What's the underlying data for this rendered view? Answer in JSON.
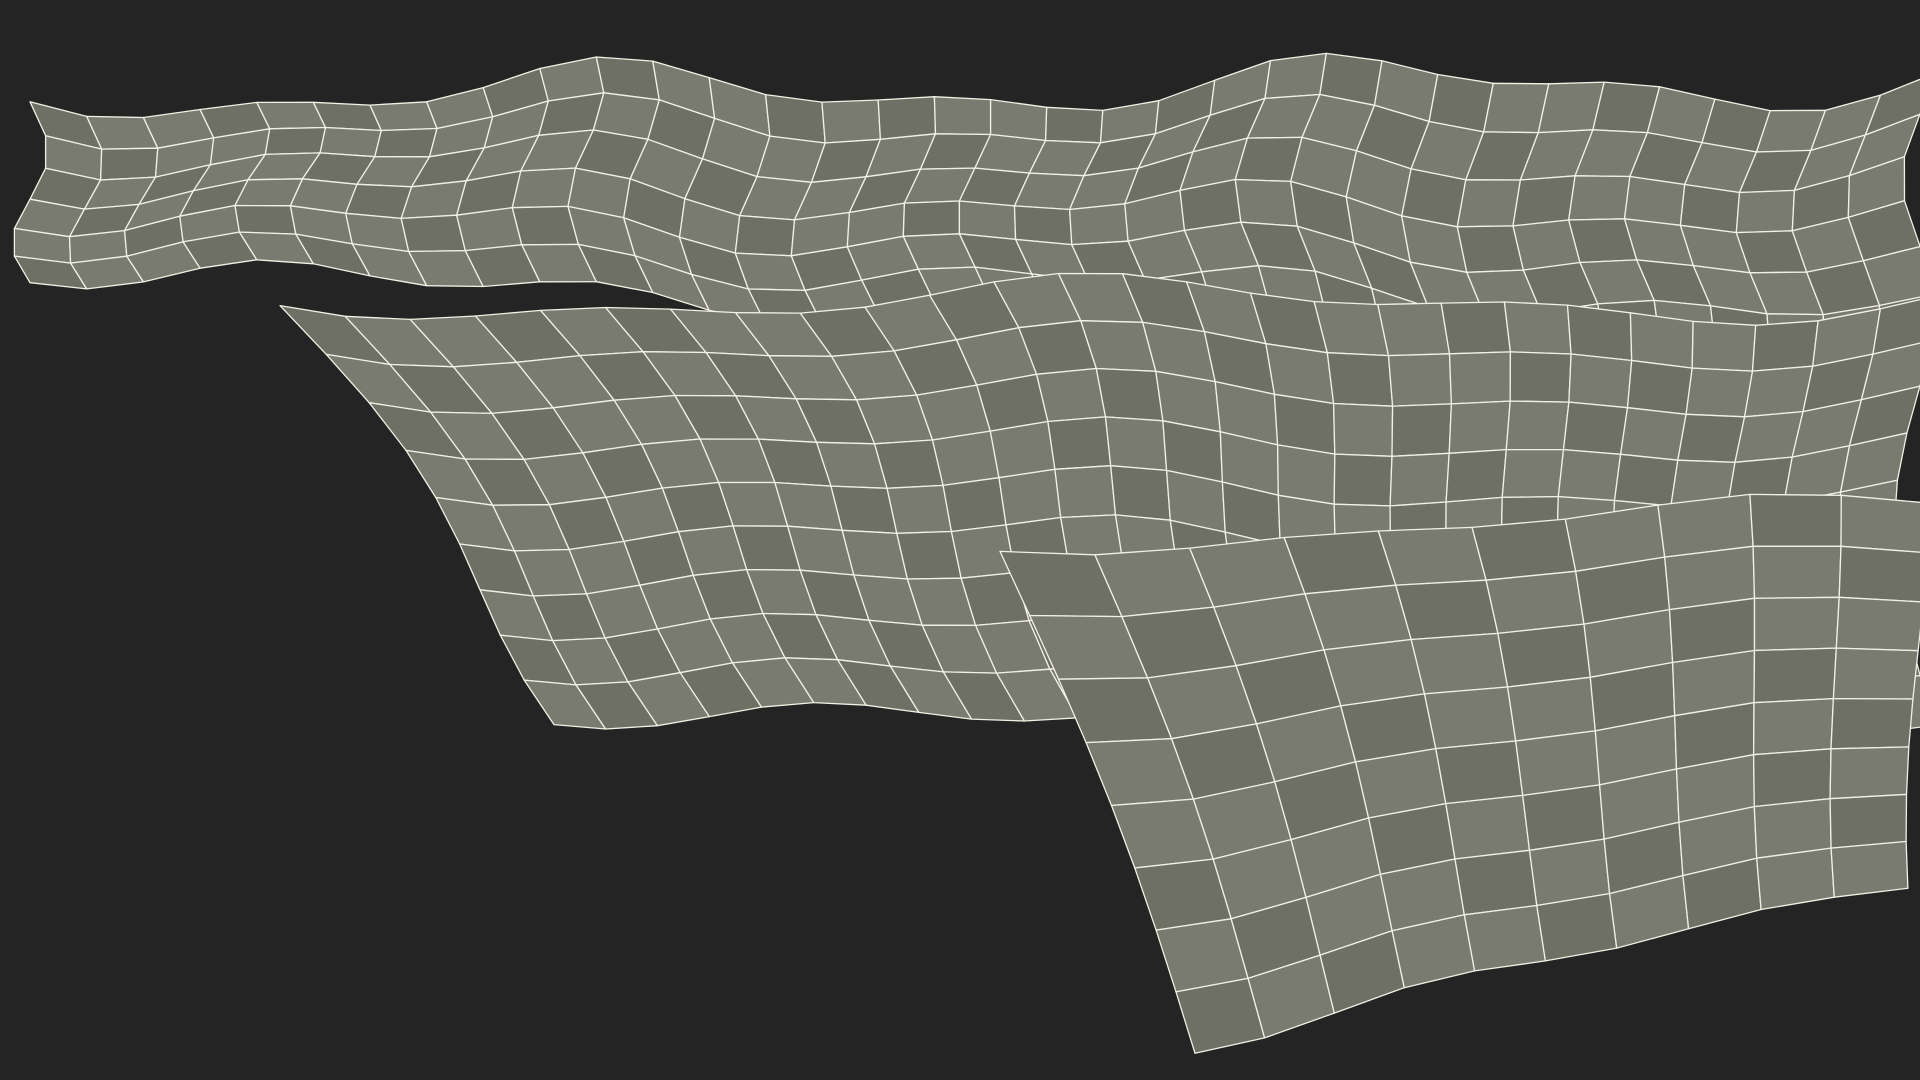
{
  "scene": {
    "type": "3d-wireframe-terrain-render",
    "background_color": "#242424",
    "surface_color": "#7a7b70",
    "surface_shade_color": "#6e6f65",
    "wire_color": "#f2f0e4"
  }
}
